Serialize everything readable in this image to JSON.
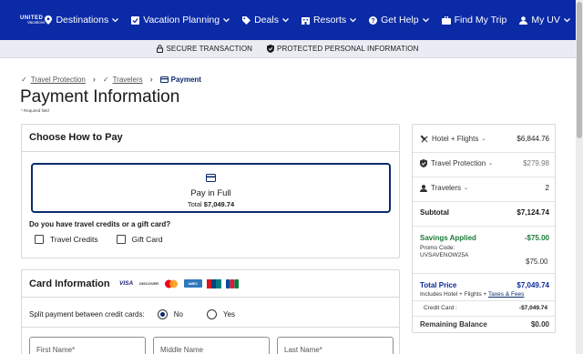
{
  "logo": {
    "line1": "UNITED",
    "line2": "Vacations"
  },
  "nav": [
    {
      "label": "Destinations",
      "icon": "pin-icon",
      "chev": true
    },
    {
      "label": "Vacation Planning",
      "icon": "checklist-icon",
      "chev": true
    },
    {
      "label": "Deals",
      "icon": "tag-icon",
      "chev": true
    },
    {
      "label": "Resorts",
      "icon": "building-icon",
      "chev": true
    },
    {
      "label": "Get Help",
      "icon": "help-icon",
      "chev": true
    },
    {
      "label": "Find My Trip",
      "icon": "suitcase-icon",
      "chev": false
    },
    {
      "label": "My UV",
      "icon": "user-icon",
      "chev": true
    }
  ],
  "secure": {
    "left": "SECURE TRANSACTION",
    "right": "PROTECTED PERSONAL INFORMATION"
  },
  "breadcrumb": {
    "step1": "Travel Protection",
    "step2": "Travelers",
    "step3": "Payment"
  },
  "page": {
    "title": "Payment Information",
    "required": "* Required field"
  },
  "choose": {
    "title": "Choose How to Pay",
    "pay_full": "Pay in Full",
    "total_label": "Total",
    "total_value": "$7,049.74",
    "credits_q": "Do you have travel credits or a gift card?",
    "opt1": "Travel Credits",
    "opt2": "Gift Card"
  },
  "card_info": {
    "title": "Card Information",
    "brands": [
      "VISA",
      "DISCOVER",
      "MC",
      "AMEX",
      "UNIONPAY",
      "JCB"
    ],
    "split_q": "Split payment between credit cards:",
    "no": "No",
    "yes": "Yes",
    "first_name": "First Name*",
    "middle_name": "Middle Name",
    "last_name": "Last Name*"
  },
  "summary": {
    "hotel_flights": {
      "label": "Hotel + Flights",
      "value": "$6,844.76"
    },
    "protection": {
      "label": "Travel Protection",
      "value": "$279.98"
    },
    "travelers": {
      "label": "Travelers",
      "value": "2"
    },
    "subtotal": {
      "label": "Subtotal",
      "value": "$7,124.74"
    },
    "savings": {
      "label": "Savings Applied",
      "value": "-$75.00"
    },
    "promo_label": "Promo Code:",
    "promo_code": "UVSAVENOW25A",
    "promo_value": "$75.00",
    "total_price": {
      "label": "Total Price",
      "value": "$7,049.74"
    },
    "includes": "Includes Hotel + Flights + ",
    "taxes": "Taxes & Fees",
    "credit_card": {
      "label": "Credit Card :",
      "value": "-$7,049.74"
    },
    "remaining": {
      "label": "Remaining Balance",
      "value": "$0.00"
    }
  },
  "colors": {
    "brand": "#0b2aa6",
    "navy": "#0b2a6b",
    "green": "#1d7a3a"
  }
}
